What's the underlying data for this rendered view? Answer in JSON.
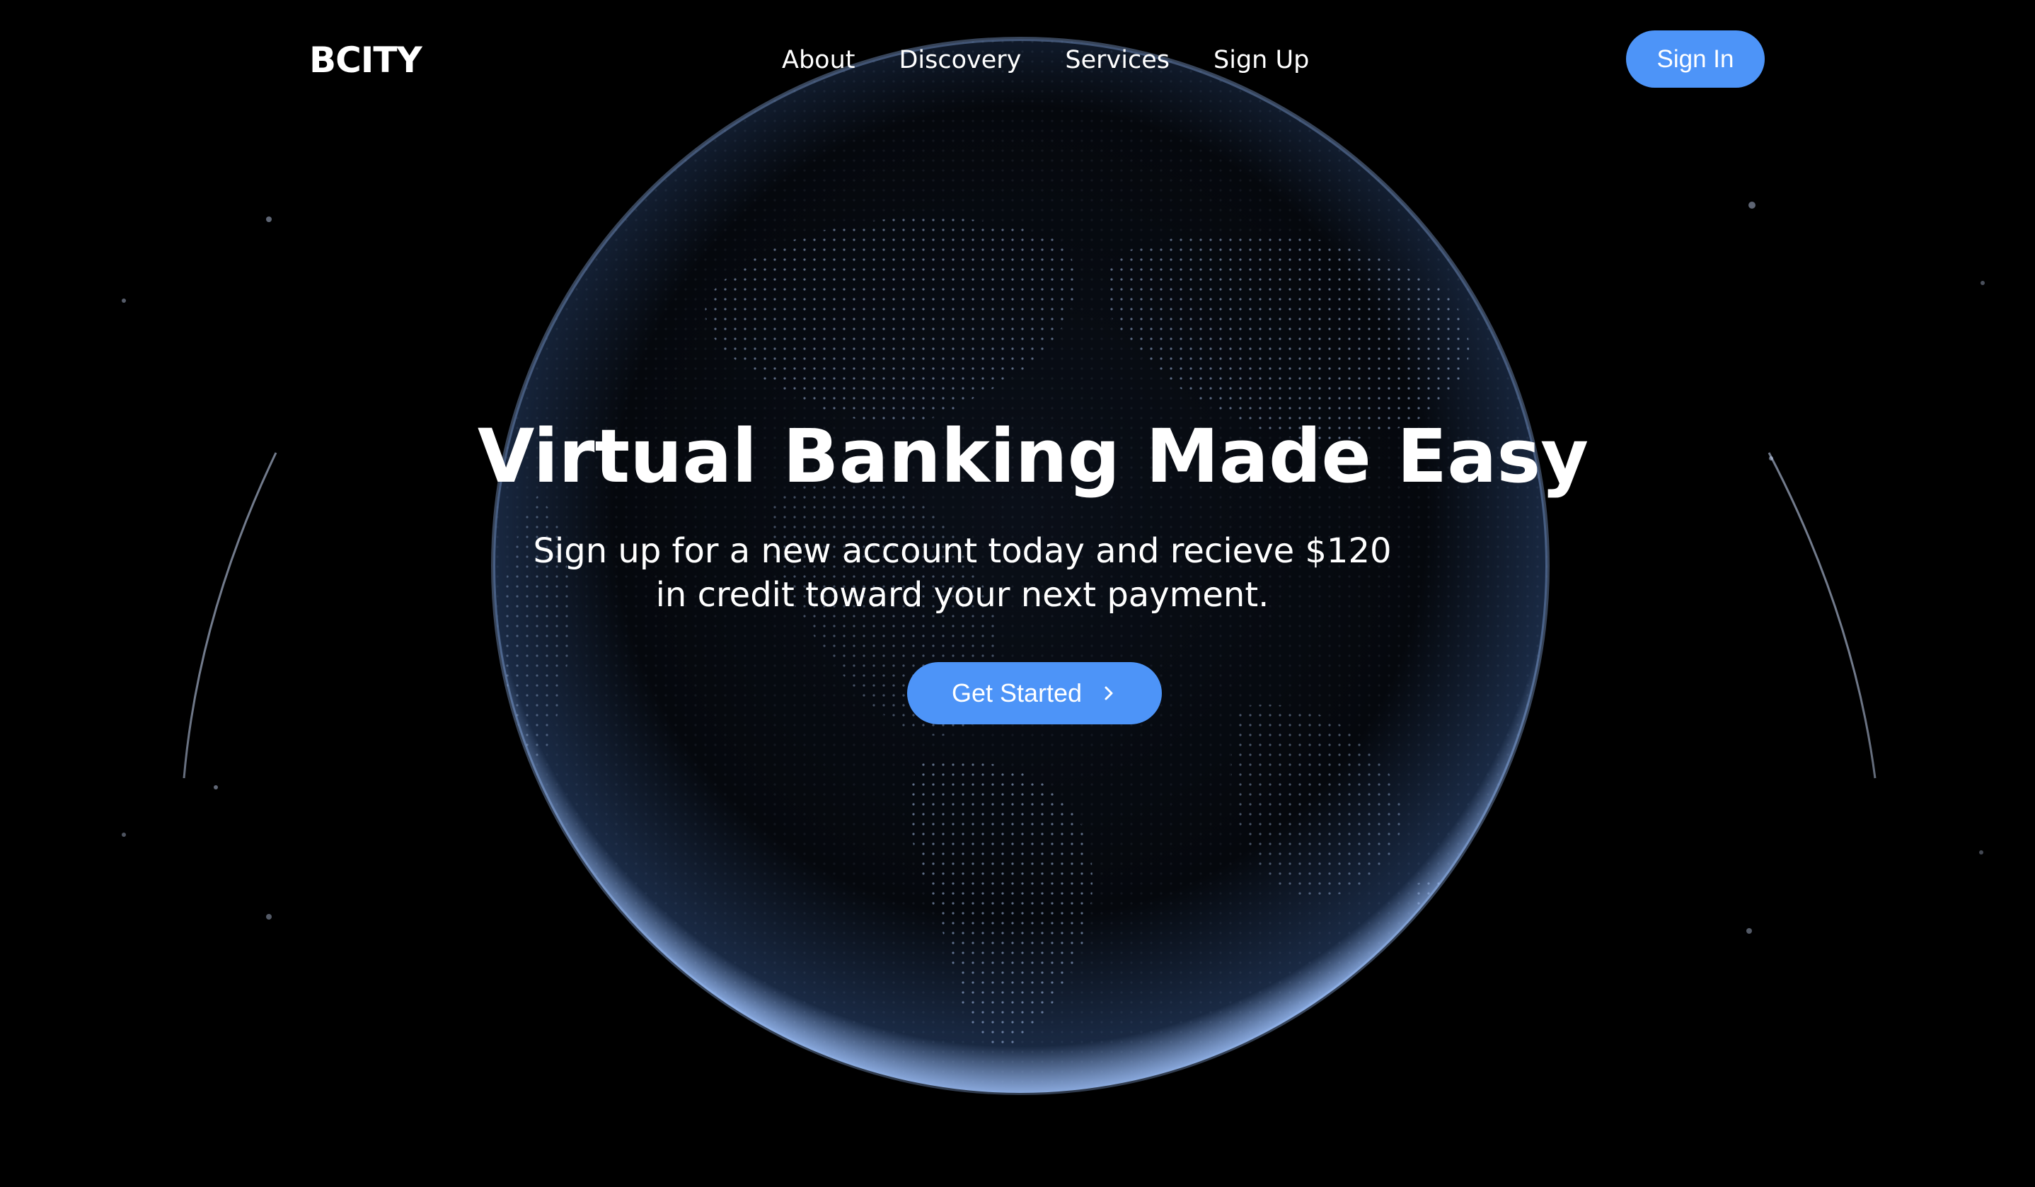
{
  "brand": {
    "name": "BCITY"
  },
  "nav": {
    "links": [
      {
        "label": "About"
      },
      {
        "label": "Discovery"
      },
      {
        "label": "Services"
      },
      {
        "label": "Sign Up"
      }
    ],
    "signin_label": "Sign In"
  },
  "hero": {
    "title": "Virtual Banking Made Easy",
    "subtitle_line1": "Sign up for a new account today and recieve $120",
    "subtitle_line2": "in credit toward your next payment.",
    "cta_label": "Get Started",
    "cta_icon": "chevron-right-icon"
  },
  "theme": {
    "background": "#000000",
    "accent": "#4d94f8",
    "globe_glow": "#9fc3ff"
  }
}
